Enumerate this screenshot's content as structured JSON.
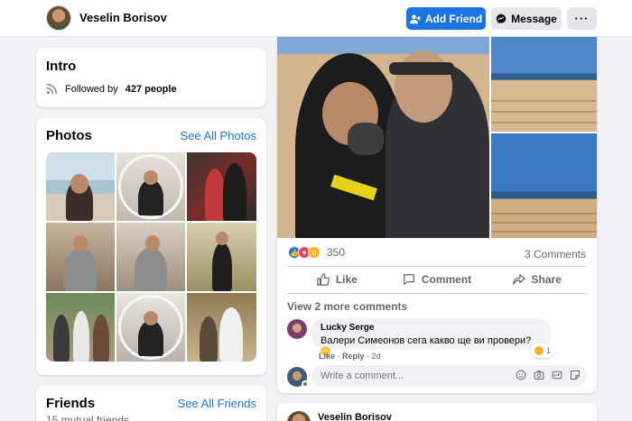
{
  "header": {
    "profile_name": "Veselin Borisov",
    "add_friend_label": "Add Friend",
    "message_label": "Message",
    "more_label": "···"
  },
  "intro": {
    "title": "Intro",
    "followed_prefix": "Followed by",
    "followed_count": "427 people"
  },
  "photos": {
    "title": "Photos",
    "see_all": "See All Photos",
    "thumbnail_count": 9
  },
  "friends": {
    "title": "Friends",
    "see_all": "See All Friends",
    "mutual": "15 mutual friends"
  },
  "post": {
    "reaction_count": "350",
    "comments_count": "3 Comments",
    "actions": {
      "like": "Like",
      "comment": "Comment",
      "share": "Share"
    },
    "view_more": "View 2 more comments",
    "comment": {
      "author": "Lucky Serge",
      "text": "Валери Симеонов сега какво ще ви провери?",
      "reaction_count": "1",
      "like_label": "Like",
      "reply_label": "Reply",
      "age": "2d"
    },
    "input_placeholder": "Write a comment..."
  },
  "next_post": {
    "author": "Veselin Borisov"
  },
  "colors": {
    "accent": "#1b74e4",
    "background": "#f0f2f5",
    "secondary_text": "#65676b"
  }
}
